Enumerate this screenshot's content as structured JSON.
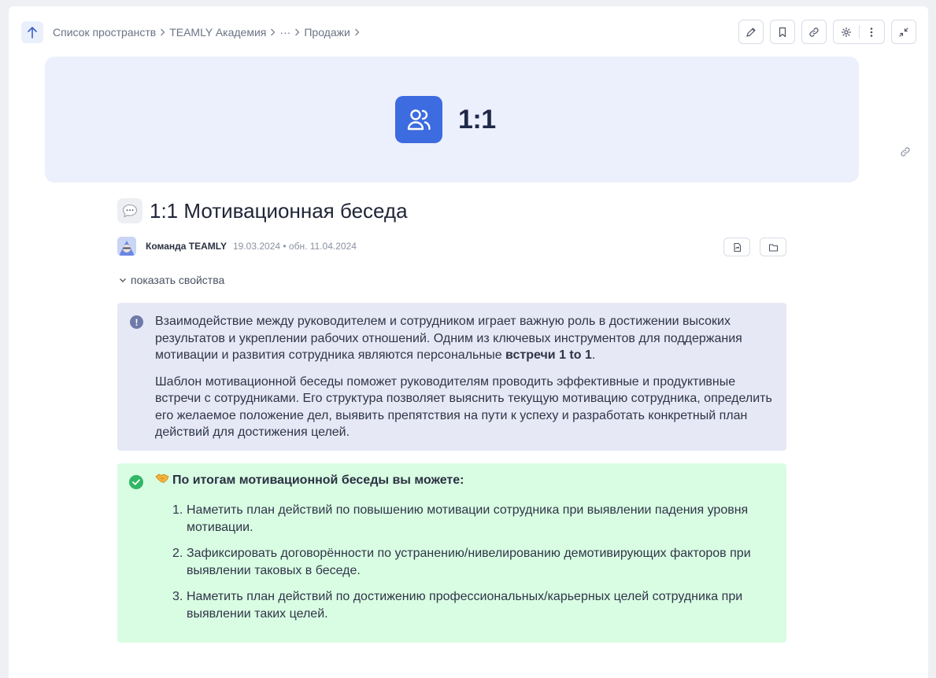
{
  "breadcrumb": {
    "items": [
      "Список пространств",
      "TEAMLY Академия",
      "···",
      "Продажи"
    ]
  },
  "toolbar": {
    "edit_icon": "pencil-icon",
    "bookmark_icon": "bookmark-icon",
    "link_icon": "link-icon",
    "settings_icon": "gear-icon",
    "more_icon": "more-vertical-icon",
    "collapse_icon": "collapse-icon"
  },
  "cover": {
    "icon": "people-icon",
    "title": "1:1",
    "bg_color": "#eceffc",
    "icon_color": "#3d6be0"
  },
  "page": {
    "emoji": "💬",
    "title": "1:1 Мотивационная беседа",
    "author": "Команда TEAMLY",
    "dates": "19.03.2024 • обн. 11.04.2024",
    "props_toggle": "показать свойства"
  },
  "info_callout": {
    "paragraph1_start": "Взаимодействие между руководителем и сотрудником играет важную роль в достижении высоких результатов и укреплении рабочих отношений. Одним из ключевых инструментов для поддержания мотивации и развития сотрудника являются персональные ",
    "paragraph1_bold": "встречи 1 to 1",
    "paragraph1_end": ".",
    "paragraph2": "Шаблон мотивационной беседы поможет руководителям проводить эффективные и продуктивные встречи с сотрудниками. Его структура позволяет выяснить текущую мотивацию сотрудника, определить его желаемое положение дел, выявить препятствия на пути к успеху и разработать конкретный план действий для достижения целей.",
    "bg_color": "#e6e8f5"
  },
  "success_callout": {
    "emoji": "🤝",
    "heading": "По итогам мотивационной беседы вы можете:",
    "items": [
      {
        "num": "1.",
        "text": "Наметить план действий по повышению мотивации сотрудника при выявлении падения уровня мотивации."
      },
      {
        "num": "2.",
        "text": "Зафиксировать договорённости по устранению/нивелированию демотивирующих факторов при выявлении таковых в беседе."
      },
      {
        "num": "3.",
        "text": "Наметить план действий по достижению профессиональных/карьерных целей сотрудника при выявлении таких целей."
      }
    ],
    "bg_color": "#d9fde3",
    "accent": "#2fb766"
  }
}
